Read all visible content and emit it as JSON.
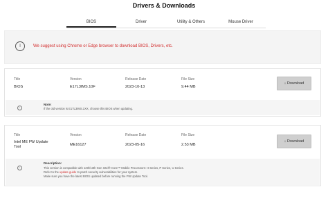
{
  "page": {
    "title": "Drivers & Downloads"
  },
  "tabs": [
    "BIOS",
    "Driver",
    "Utility & Others",
    "Mouse Driver"
  ],
  "notice": {
    "icon": "info-icon",
    "message": "We suggest using Chrome or Edge browser to download BIOS, Drivers, etc."
  },
  "columns": {
    "title": "Title",
    "version": "Version",
    "release_date": "Release Date",
    "file_size": "File Size"
  },
  "items": [
    {
      "title": "BIOS",
      "version": "E17L3IMS.10F",
      "release_date": "2023-10-13",
      "file_size": "9.44 MB",
      "download_label": "↓ Download",
      "note_heading": "Note:",
      "note_lines": [
        "If the old version is E17L3IMS.1XX, choose this BIOS when updating."
      ]
    },
    {
      "title_line1": "Intel ME FW Update",
      "title_line2": "Tool",
      "version": "ME16127",
      "release_date": "2023-05-16",
      "file_size": "2.53 MB",
      "download_label": "↓ Download",
      "note_heading": "Description:",
      "note_line1": "This version is compatible with 12th/13th Gen Intel® Core™ Mobile Processors: H Series, P Series, U Series.",
      "note_line2_prefix": "Refer to the ",
      "note_line2_link": "update guide",
      "note_line2_suffix": " to patch security vulnerabilities for your system.",
      "note_line3": "Make sure you have the latest BIOS updated before running the FW Update Tool."
    }
  ],
  "colors": {
    "accent_red": "#d32f2f",
    "button_gray": "#cfcfcf"
  }
}
